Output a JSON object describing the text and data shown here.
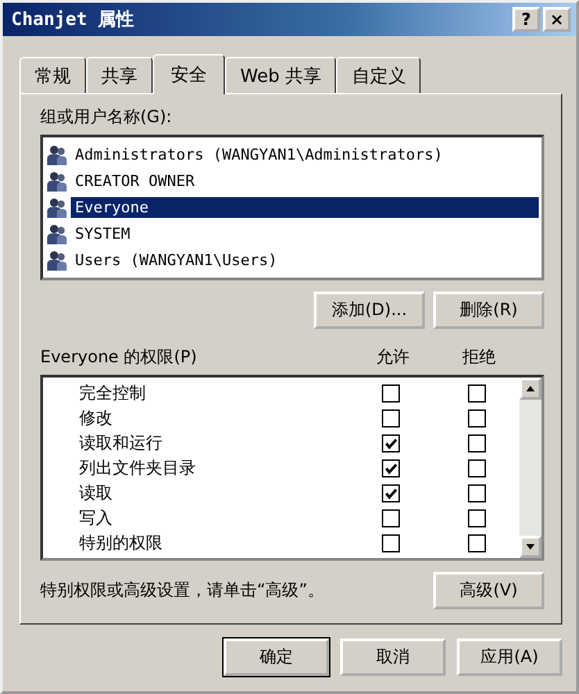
{
  "window": {
    "title": "Chanjet 属性",
    "title_buttons": [
      "?",
      "×"
    ]
  },
  "tabs": [
    {
      "label": "常规",
      "selected": false
    },
    {
      "label": "共享",
      "selected": false
    },
    {
      "label": "安全",
      "selected": true
    },
    {
      "label": "Web 共享",
      "selected": false
    },
    {
      "label": "自定义",
      "selected": false
    }
  ],
  "users": {
    "label": "组或用户名称(G):",
    "items": [
      {
        "name": "Administrators (WANGYAN1\\Administrators)",
        "selected": false
      },
      {
        "name": "CREATOR OWNER",
        "selected": false
      },
      {
        "name": "Everyone",
        "selected": true
      },
      {
        "name": "SYSTEM",
        "selected": false
      },
      {
        "name": "Users (WANGYAN1\\Users)",
        "selected": false
      }
    ],
    "buttons": [
      "添加(D)...",
      "删除(R)"
    ]
  },
  "permissions": {
    "label": "Everyone 的权限(P)",
    "allow_header": "允许",
    "deny_header": "拒绝",
    "items": [
      {
        "name": "完全控制",
        "allow": false,
        "deny": false
      },
      {
        "name": "修改",
        "allow": false,
        "deny": false
      },
      {
        "name": "读取和运行",
        "allow": true,
        "deny": false
      },
      {
        "name": "列出文件夹目录",
        "allow": true,
        "deny": false
      },
      {
        "name": "读取",
        "allow": true,
        "deny": false
      },
      {
        "name": "写入",
        "allow": false,
        "deny": false
      },
      {
        "name": "特别的权限",
        "allow": false,
        "deny": false
      }
    ]
  },
  "advanced": {
    "hint": "特别权限或高级设置，请单击“高级”。",
    "button": "高级(V)"
  },
  "footer_buttons": [
    {
      "label": "确定",
      "default": true
    },
    {
      "label": "取消",
      "default": false
    },
    {
      "label": "应用(A)",
      "default": false
    }
  ]
}
